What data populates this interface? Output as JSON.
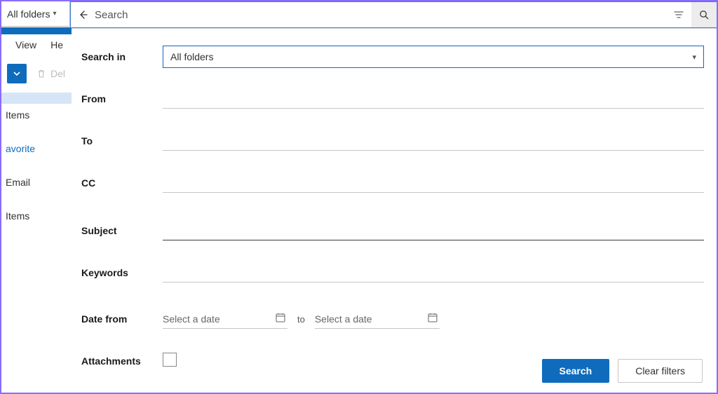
{
  "scope": {
    "label": "All folders"
  },
  "searchbar": {
    "placeholder": "Search"
  },
  "menubar": {
    "view": "View",
    "help": "He"
  },
  "toolbar": {
    "delete": "Del"
  },
  "sidebar": {
    "items": [
      {
        "label": ""
      },
      {
        "label": "Items"
      },
      {
        "label": ""
      },
      {
        "label": "avorite"
      },
      {
        "label": ""
      },
      {
        "label": "Email"
      },
      {
        "label": ""
      },
      {
        "label": "Items"
      }
    ]
  },
  "panel": {
    "search_in": {
      "label": "Search in",
      "value": "All folders"
    },
    "from": {
      "label": "From",
      "value": ""
    },
    "to": {
      "label": "To",
      "value": ""
    },
    "cc": {
      "label": "CC",
      "value": ""
    },
    "subject": {
      "label": "Subject",
      "value": ""
    },
    "keywords": {
      "label": "Keywords",
      "value": ""
    },
    "date": {
      "label": "Date from",
      "from_placeholder": "Select a date",
      "to_word": "to",
      "to_placeholder": "Select a date"
    },
    "attachments": {
      "label": "Attachments",
      "checked": false
    },
    "actions": {
      "search": "Search",
      "clear": "Clear filters"
    }
  }
}
